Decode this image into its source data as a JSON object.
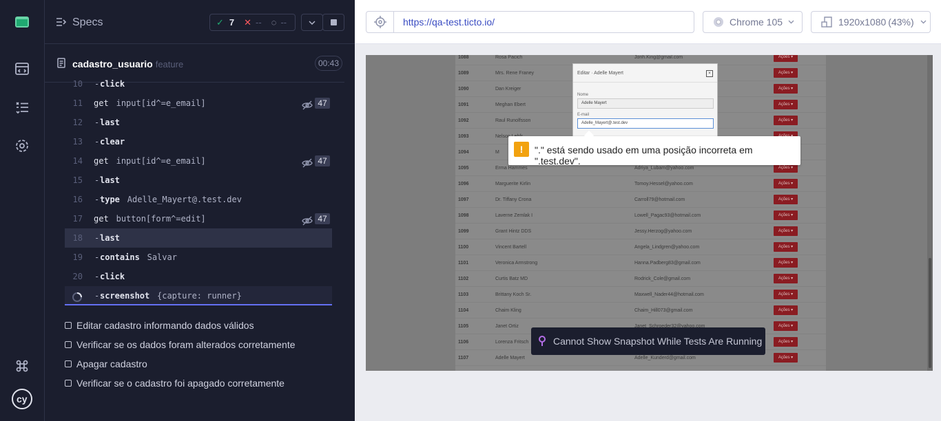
{
  "specs_header": {
    "title": "Specs",
    "passed": "7",
    "failed": "--",
    "pending": "--"
  },
  "spec_file": {
    "name": "cadastro_usuario",
    "ext": "feature",
    "duration": "00:43"
  },
  "commands": [
    {
      "num": "10",
      "name": "click",
      "msg": "",
      "child": true
    },
    {
      "num": "11",
      "name": "get",
      "msg": "input[id^=e_email]",
      "child": false,
      "count": "47"
    },
    {
      "num": "12",
      "name": "last",
      "msg": "",
      "child": true
    },
    {
      "num": "13",
      "name": "clear",
      "msg": "",
      "child": true
    },
    {
      "num": "14",
      "name": "get",
      "msg": "input[id^=e_email]",
      "child": false,
      "count": "47"
    },
    {
      "num": "15",
      "name": "last",
      "msg": "",
      "child": true
    },
    {
      "num": "16",
      "name": "type",
      "msg": "Adelle_Mayert@.test.dev",
      "child": true
    },
    {
      "num": "17",
      "name": "get",
      "msg": "button[form^=edit]",
      "child": false,
      "count": "47"
    },
    {
      "num": "18",
      "name": "last",
      "msg": "",
      "child": true
    },
    {
      "num": "19",
      "name": "contains",
      "msg": "Salvar",
      "child": true
    },
    {
      "num": "20",
      "name": "click",
      "msg": "",
      "child": true
    },
    {
      "num": "",
      "name": "screenshot",
      "msg": "{capture: runner}",
      "child": true
    }
  ],
  "tests": [
    "Editar cadastro informando dados válidos",
    "Verificar se os dados foram alterados corretamente",
    "Apagar cadastro",
    "Verificar se o cadastro foi apagado corretamente"
  ],
  "browser": {
    "url": "https://qa-test.ticto.io/",
    "browser_label": "Chrome 105",
    "viewport_label": "1920x1080",
    "viewport_scale": "(43%)"
  },
  "aut": {
    "modal": {
      "title": "Editar · Adelle Mayert",
      "close": "×",
      "name_label": "Nome",
      "name_value": "Adelle Mayert",
      "email_label": "E-mail",
      "email_value": "Adelle_Mayert@.test.dev"
    },
    "validation_tooltip": "\".\" está sendo usado em uma posição incorreta em \".test.dev\".",
    "action_label": "Ações ▾",
    "rows": [
      {
        "id": "1088",
        "name": "Rosa Pacich",
        "email": "Jonh.King@gmail.com"
      },
      {
        "id": "1089",
        "name": "Mrs. Rene Franey",
        "email": ""
      },
      {
        "id": "1090",
        "name": "Dan Kreiger",
        "email": ""
      },
      {
        "id": "1091",
        "name": "Meghan Ebert",
        "email": ""
      },
      {
        "id": "1092",
        "name": "Raul Runolfsson",
        "email": ""
      },
      {
        "id": "1093",
        "name": "Nelson Lehfr",
        "email": ""
      },
      {
        "id": "1094",
        "name": "M",
        "email": ""
      },
      {
        "id": "1095",
        "name": "Erma Hammes",
        "email": "Adriya_Lubam@yahoo.com"
      },
      {
        "id": "1096",
        "name": "Marguerite Kirlin",
        "email": "Tomoy.Hessel@yahoo.com"
      },
      {
        "id": "1097",
        "name": "Dr. Tiffany Crona",
        "email": "Carroll79@hotmail.com"
      },
      {
        "id": "1098",
        "name": "Laverne Zemlak I",
        "email": "Lowell_Pagac93@hotmail.com"
      },
      {
        "id": "1099",
        "name": "Grant Hintz DDS",
        "email": "Jessy.Herzog@yahoo.com"
      },
      {
        "id": "1100",
        "name": "Vincent Bartell",
        "email": "Angela_Lindgren@yahoo.com"
      },
      {
        "id": "1101",
        "name": "Veronica Armstrong",
        "email": "Hanna.Padberg83@gmail.com"
      },
      {
        "id": "1102",
        "name": "Curtis Batz MD",
        "email": "Rodrick_Cole@gmail.com"
      },
      {
        "id": "1103",
        "name": "Brittany Koch Sr.",
        "email": "Maxwell_Nader44@hotmail.com"
      },
      {
        "id": "1104",
        "name": "Chaim Kling",
        "email": "Chaim_Hill073@gmail.com"
      },
      {
        "id": "1105",
        "name": "Janet Ortiz",
        "email": "Janet_Schroeder32@yahoo.com"
      },
      {
        "id": "1106",
        "name": "Lorenza Fritsch",
        "email": ""
      },
      {
        "id": "1107",
        "name": "Adelle Mayert",
        "email": "Adelle_Kunderd@gmail.com"
      }
    ],
    "snapshot_message": "Cannot Show Snapshot While Tests Are Running"
  },
  "colors": {
    "passed": "#1fa971",
    "failed": "#ff5a5f",
    "accent": "#6470f3",
    "link": "#3a4cc2",
    "warning": "#f2a20f"
  }
}
